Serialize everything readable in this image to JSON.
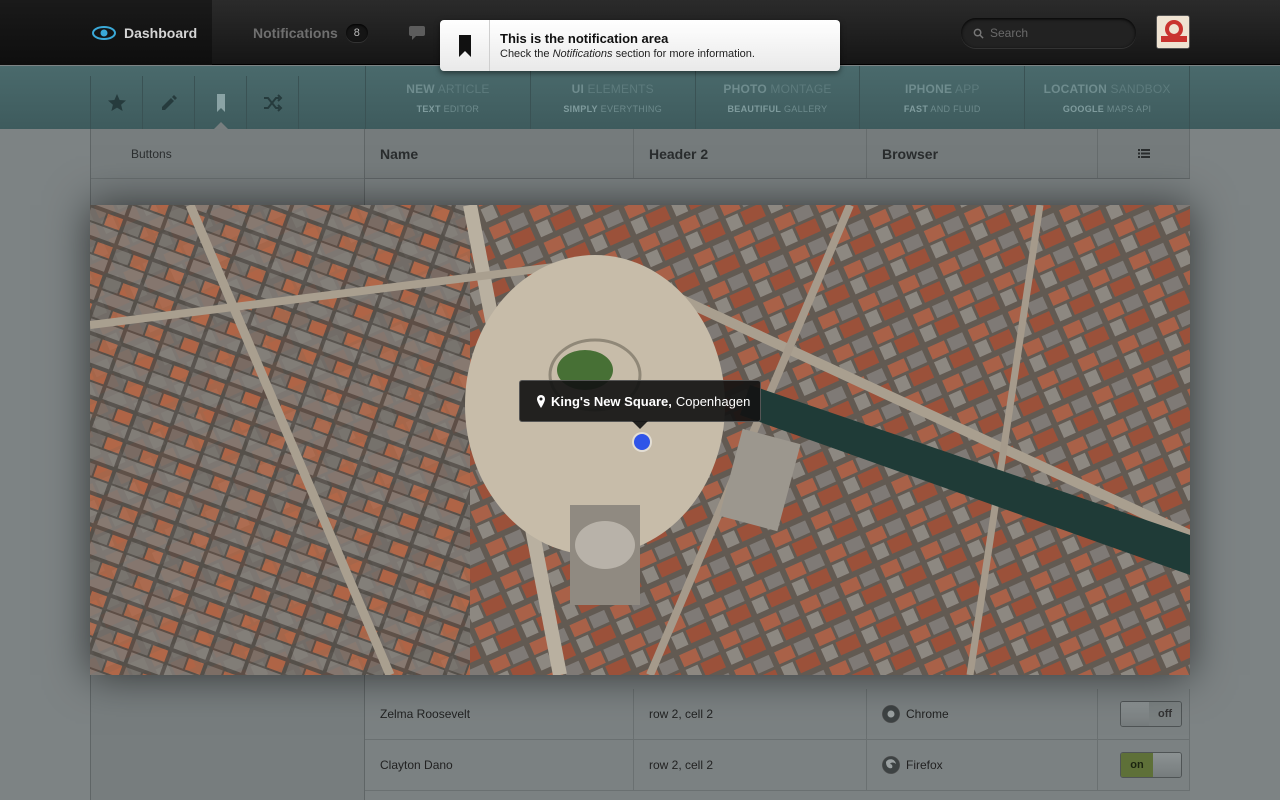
{
  "topbar": {
    "dashboard_label": "Dashboard",
    "notifications_label": "Notifications",
    "notifications_count": "8",
    "search_placeholder": "Search"
  },
  "notification": {
    "title": "This is the notification area",
    "body_prefix": "Check the ",
    "body_emphasis": "Notifications",
    "body_suffix": " section for more information."
  },
  "iconbar": {
    "icons": [
      "star-icon",
      "pencil-icon",
      "bookmark-icon",
      "shuffle-icon"
    ],
    "active_index": 2
  },
  "shortcuts": [
    {
      "title_bold": "NEW",
      "title_rest": " ARTICLE",
      "sub_bold": "TEXT",
      "sub_rest": " EDITOR"
    },
    {
      "title_bold": "UI",
      "title_rest": " ELEMENTS",
      "sub_bold": "SIMPLY",
      "sub_rest": " EVERYTHING"
    },
    {
      "title_bold": "PHOTO",
      "title_rest": " MONTAGE",
      "sub_bold": "BEAUTIFUL",
      "sub_rest": " GALLERY"
    },
    {
      "title_bold": "IPHONE",
      "title_rest": " APP",
      "sub_bold": "FAST",
      "sub_rest": " AND FLUID"
    },
    {
      "title_bold": "LOCATION",
      "title_rest": " SANDBOX",
      "sub_bold": "GOOGLE",
      "sub_rest": " MAPS API"
    }
  ],
  "sidebar": {
    "items": [
      "Buttons"
    ]
  },
  "table": {
    "headers": [
      "Name",
      "Header 2",
      "Browser"
    ],
    "rows": [
      {
        "name": "Zelma Roosevelt",
        "col2": "row 2, cell 2",
        "browser": "Chrome",
        "toggle": "off"
      },
      {
        "name": "Clayton Dano",
        "col2": "row 2, cell 2",
        "browser": "Firefox",
        "toggle": "on"
      }
    ]
  },
  "map": {
    "place_name": "King's New Square,",
    "city": "Copenhagen"
  },
  "colors": {
    "teal": "#4a6a6c",
    "dot": "#2f54e8",
    "toggle_on": "#5e7038"
  }
}
